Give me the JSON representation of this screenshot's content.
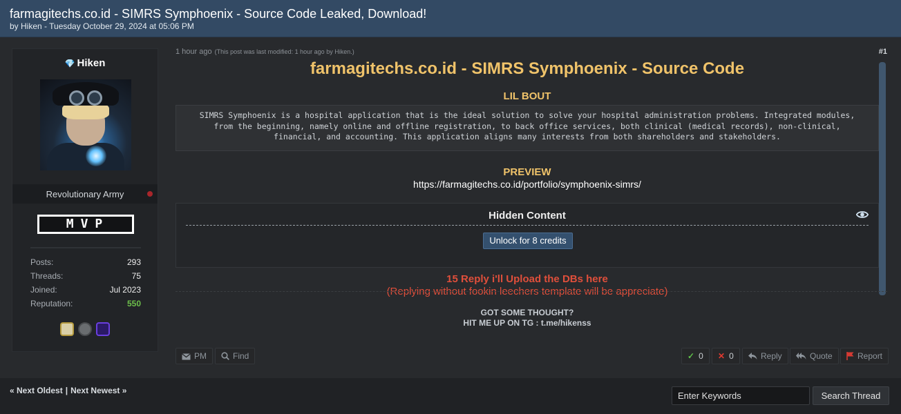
{
  "thread": {
    "title": "farmagitechs.co.id - SIMRS Symphoenix - Source Code Leaked, Download!",
    "meta": "by Hiken - Tuesday October 29, 2024 at 05:06 PM"
  },
  "author": {
    "name": "Hiken",
    "rank": "Revolutionary Army",
    "userbar": "MVP",
    "stats": [
      {
        "label": "Posts:",
        "value": "293"
      },
      {
        "label": "Threads:",
        "value": "75"
      },
      {
        "label": "Joined:",
        "value": "Jul 2023"
      },
      {
        "label": "Reputation:",
        "value": "550"
      }
    ],
    "awards": [
      "award-badge",
      "award-badge",
      "award-badge"
    ]
  },
  "post": {
    "time": "1 hour ago",
    "modified": "(This post was last modified: 1 hour ago by Hiken.)",
    "number": "#1",
    "heading": "farmagitechs.co.id - SIMRS Symphoenix - Source Code",
    "section1_title": "LIL BOUT",
    "code_lines": [
      "SIMRS Symphoenix is a hospital application that is the ideal solution to solve your hospital administration problems. Integrated modules,",
      "from the beginning, namely online and offline registration, to back office services, both clinical (medical records), non-clinical,",
      "financial, and accounting. This application aligns many interests from both shareholders and stakeholders."
    ],
    "section2_title": "PREVIEW",
    "preview_link": "https://farmagitechs.co.id/portfolio/symphoenix-simrs/",
    "hidden_title": "Hidden Content",
    "unlock_label": "Unlock for 8 credits",
    "red_line1": "15 Reply i'll Upload the DBs here",
    "red_line2": "(Replying without fookin leechers template will be appreciate)",
    "sig_line1": "GOT SOME THOUGHT?",
    "sig_line2": "HIT ME UP ON TG : t.me/hikenss"
  },
  "actions": {
    "pm": "PM",
    "find": "Find",
    "like_count": "0",
    "dislike_count": "0",
    "reply": "Reply",
    "quote": "Quote",
    "report": "Report"
  },
  "footer": {
    "next_oldest": "« Next Oldest",
    "separator": "|",
    "next_newest": "Next Newest »",
    "search_placeholder": "Enter Keywords",
    "search_button": "Search Thread"
  },
  "colors": {
    "header": "#334a64",
    "accent_gold": "#f0c36a",
    "alert_red": "#e04f3b",
    "reputation_green": "#6dbf4b"
  }
}
